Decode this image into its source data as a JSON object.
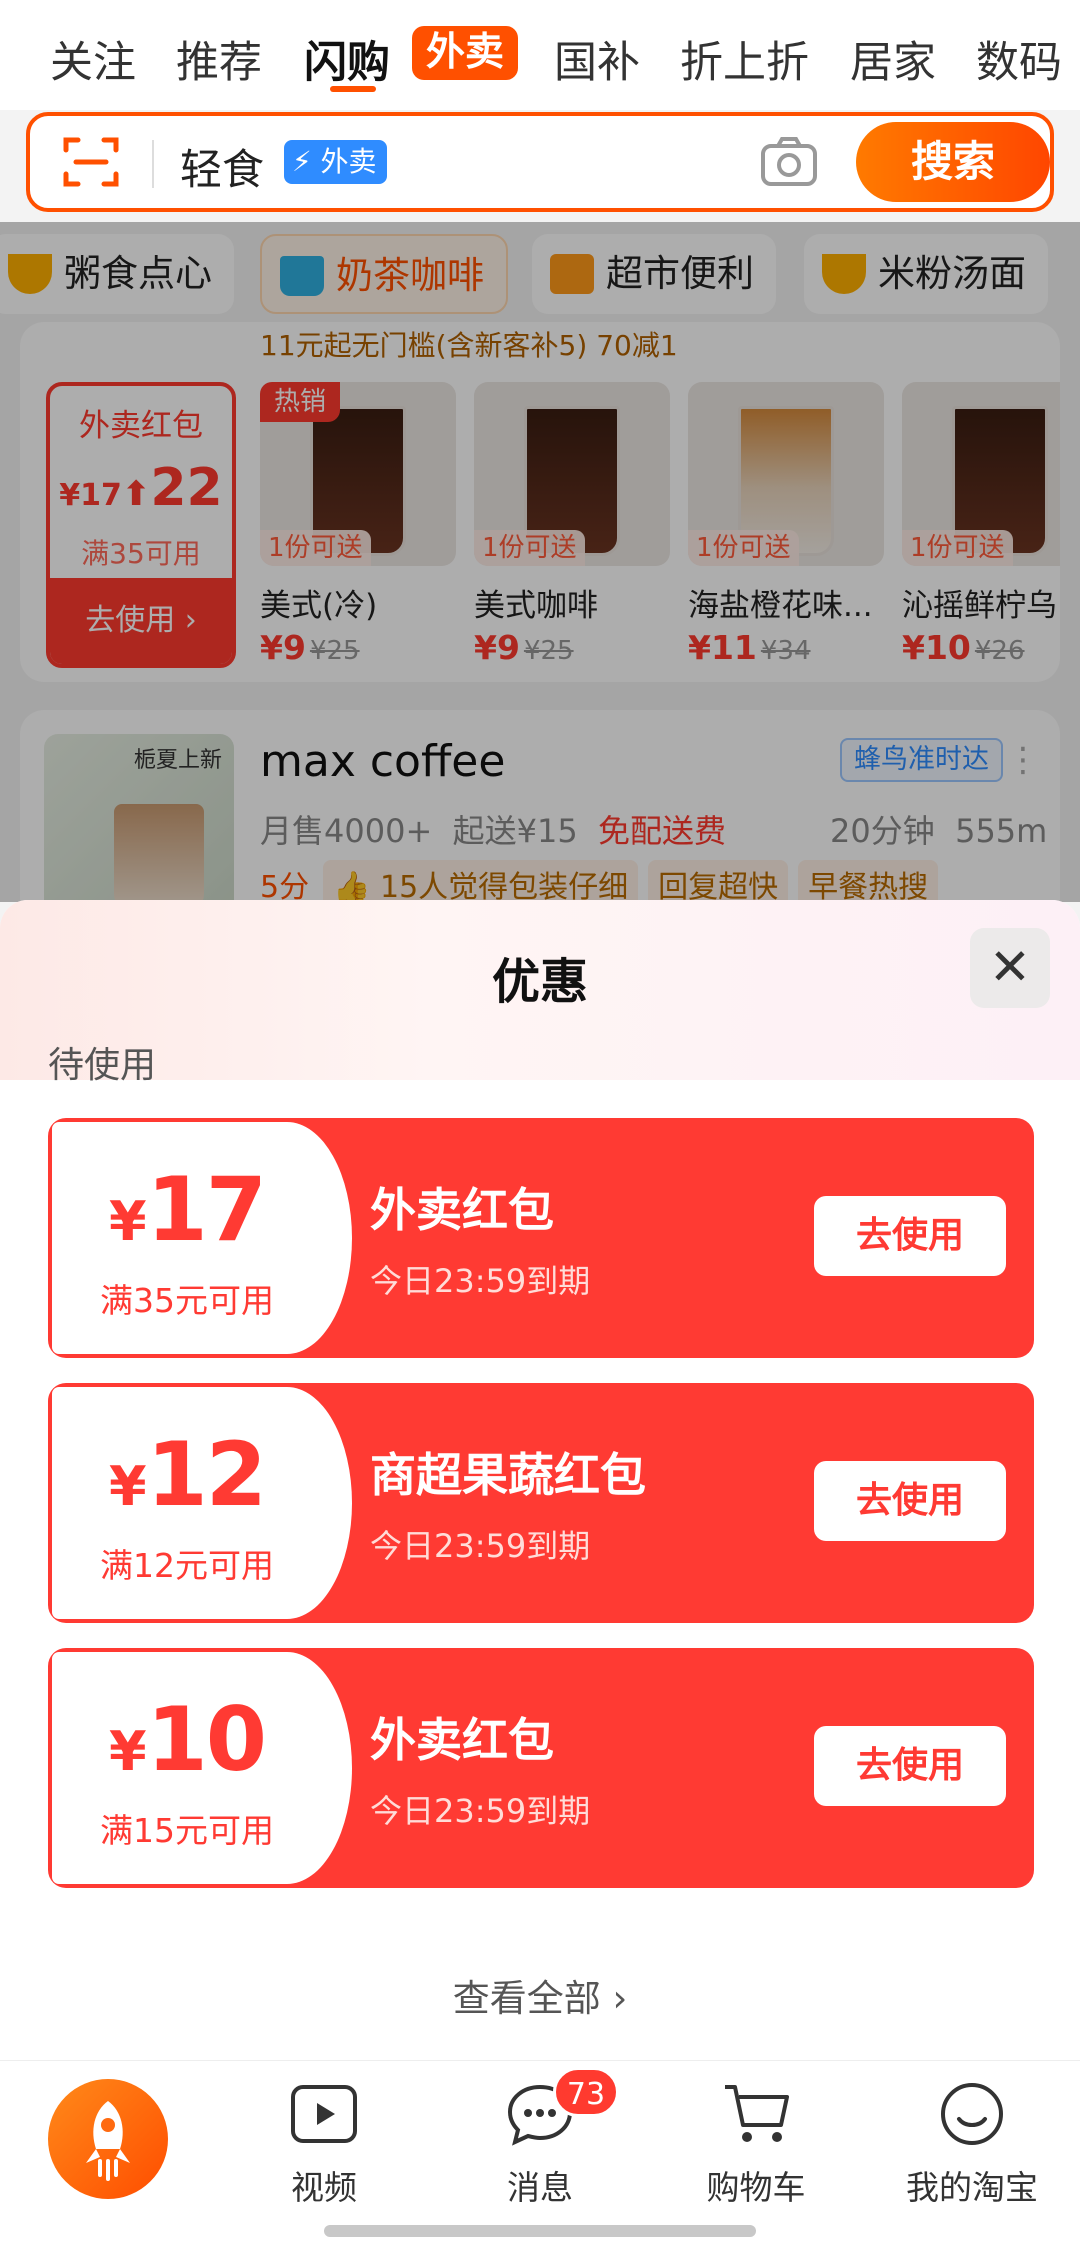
{
  "top_tabs": [
    {
      "label": "关注"
    },
    {
      "label": "推荐"
    },
    {
      "label": "闪购"
    },
    {
      "label": "外卖"
    },
    {
      "label": "国补"
    },
    {
      "label": "折上折"
    },
    {
      "label": "居家"
    },
    {
      "label": "数码"
    }
  ],
  "search": {
    "query": "轻食",
    "chip": "⚡ 外卖",
    "button": "搜索"
  },
  "categories": [
    {
      "label": "粥食点心"
    },
    {
      "label": "奶茶咖啡"
    },
    {
      "label": "超市便利"
    },
    {
      "label": "米粉汤面"
    }
  ],
  "store1": {
    "promo_strip": "11元起无门槛(含新客补5)  70减1",
    "red_packet": {
      "title": "外卖红包",
      "old": "¥17",
      "new": "22",
      "condition": "满35可用",
      "use": "去使用 ›"
    },
    "products": [
      {
        "name": "美式(冷)",
        "price": "¥9",
        "orig": "¥25",
        "gift": "1份可送",
        "hot": "热销"
      },
      {
        "name": "美式咖啡",
        "price": "¥9",
        "orig": "¥25",
        "gift": "1份可送"
      },
      {
        "name": "海盐橙花味...",
        "price": "¥11",
        "orig": "¥34",
        "gift": "1份可送"
      },
      {
        "name": "沁摇鲜柠乌",
        "price": "¥10",
        "orig": "¥26",
        "gift": "1份可送"
      }
    ]
  },
  "store2": {
    "name": "max coffee",
    "thumb_caption": "栀夏上新",
    "tag": "蜂鸟准时达",
    "sales": "月售4000+",
    "min_order": "起送¥15",
    "delivery": "免配送费",
    "time": "20分钟",
    "distance": "555m",
    "score": "5分",
    "tags": [
      "👍 15人觉得包装仔细",
      "回复超快",
      "早餐热搜"
    ]
  },
  "sheet": {
    "title": "优惠",
    "close": "✕",
    "section": "待使用",
    "coupons": [
      {
        "yen": "¥",
        "amount": "17",
        "condition": "满35元可用",
        "title": "外卖红包",
        "expiry": "今日23:59到期",
        "button": "去使用"
      },
      {
        "yen": "¥",
        "amount": "12",
        "condition": "满12元可用",
        "title": "商超果蔬红包",
        "expiry": "今日23:59到期",
        "button": "去使用"
      },
      {
        "yen": "¥",
        "amount": "10",
        "condition": "满15元可用",
        "title": "外卖红包",
        "expiry": "今日23:59到期",
        "button": "去使用"
      }
    ],
    "view_all": "查看全部 ›"
  },
  "bottom_nav": {
    "items": [
      {
        "label": "视频"
      },
      {
        "label": "消息"
      },
      {
        "label": "购物车"
      },
      {
        "label": "我的淘宝"
      }
    ],
    "message_badge": "73"
  },
  "colors": {
    "accent": "#ff5000",
    "coupon": "#ff3a33",
    "chip_blue": "#2f8cff"
  }
}
